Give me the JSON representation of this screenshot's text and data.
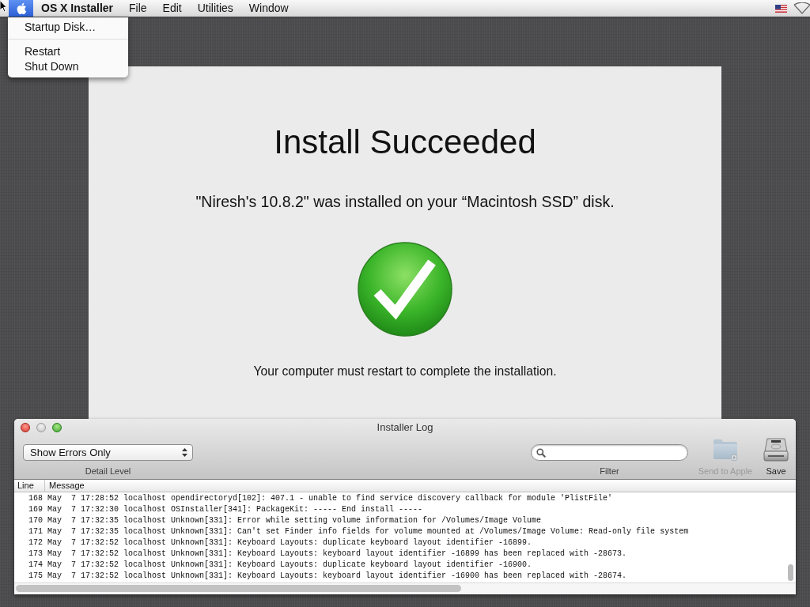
{
  "menu_bar": {
    "items": [
      {
        "kind": "apple",
        "selected": true
      },
      {
        "kind": "app",
        "label": "OS X Installer",
        "selected": false
      },
      {
        "kind": "menu",
        "label": "File",
        "selected": false
      },
      {
        "kind": "menu",
        "label": "Edit",
        "selected": false
      },
      {
        "kind": "menu",
        "label": "Utilities",
        "selected": false
      },
      {
        "kind": "menu",
        "label": "Window",
        "selected": false
      }
    ]
  },
  "apple_menu": {
    "items": [
      {
        "kind": "item",
        "label": "Startup Disk…"
      },
      {
        "kind": "separator"
      },
      {
        "kind": "item",
        "label": "Restart"
      },
      {
        "kind": "item",
        "label": "Shut Down"
      }
    ]
  },
  "installer": {
    "title": "Install Succeeded",
    "message": "\"Niresh's 10.8.2\" was installed on your “Macintosh SSD” disk.",
    "note": "Your computer must restart to complete the installation."
  },
  "log_window": {
    "title": "Installer Log",
    "window_buttons": [
      {
        "kind": "close",
        "disabled": false
      },
      {
        "kind": "minimize",
        "disabled": true
      },
      {
        "kind": "zoom",
        "disabled": false
      }
    ],
    "detail_level": {
      "value": "Show Errors Only",
      "label": "Detail Level"
    },
    "filter": {
      "label": "Filter"
    },
    "toolbar_buttons": [
      {
        "kind": "send",
        "label": "Send to Apple",
        "disabled": true
      },
      {
        "kind": "save",
        "label": "Save",
        "disabled": false
      }
    ],
    "table": {
      "columns": [
        "Line",
        "Message"
      ],
      "rows": [
        {
          "line": "168",
          "message": "May  7 17:28:52 localhost opendirectoryd[102]: 407.1 - unable to find service discovery callback for module 'PlistFile'"
        },
        {
          "line": "169",
          "message": "May  7 17:32:30 localhost OSInstaller[341]: PackageKit: ----- End install -----"
        },
        {
          "line": "170",
          "message": "May  7 17:32:35 localhost Unknown[331]: Error while setting volume information for /Volumes/Image Volume"
        },
        {
          "line": "171",
          "message": "May  7 17:32:35 localhost Unknown[331]: Can't set Finder info fields for volume mounted at /Volumes/Image Volume: Read-only file system"
        },
        {
          "line": "172",
          "message": "May  7 17:32:52 localhost Unknown[331]: Keyboard Layouts: duplicate keyboard layout identifier -16899."
        },
        {
          "line": "173",
          "message": "May  7 17:32:52 localhost Unknown[331]: Keyboard Layouts: keyboard layout identifier -16899 has been replaced with -28673."
        },
        {
          "line": "174",
          "message": "May  7 17:32:52 localhost Unknown[331]: Keyboard Layouts: duplicate keyboard layout identifier -16900."
        },
        {
          "line": "175",
          "message": "May  7 17:32:52 localhost Unknown[331]: Keyboard Layouts: keyboard layout identifier -16900 has been replaced with -28674."
        }
      ]
    }
  }
}
